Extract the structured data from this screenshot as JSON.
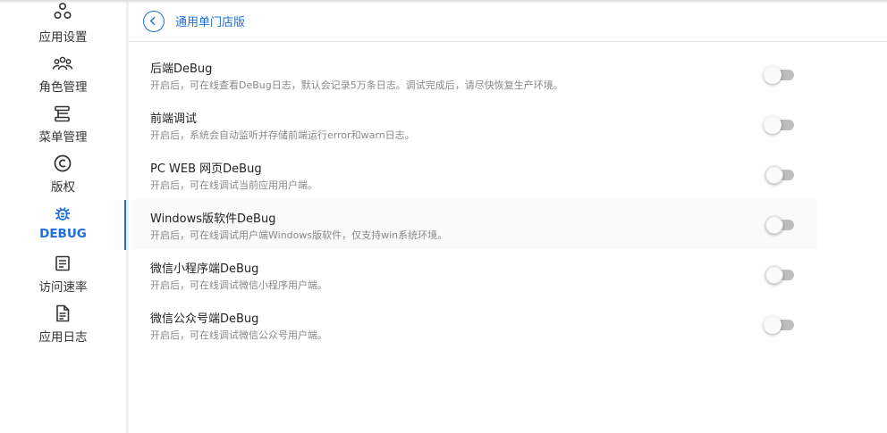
{
  "sidebar": {
    "items": [
      {
        "label": "应用设置",
        "icon": "settings-cluster-icon",
        "active": false
      },
      {
        "label": "角色管理",
        "icon": "users-group-icon",
        "active": false
      },
      {
        "label": "菜单管理",
        "icon": "menu-structure-icon",
        "active": false
      },
      {
        "label": "版权",
        "icon": "copyright-icon",
        "active": false
      },
      {
        "label": "DEBUG",
        "icon": "bug-icon",
        "active": true
      },
      {
        "label": "访问速率",
        "icon": "document-list-icon",
        "active": false
      },
      {
        "label": "应用日志",
        "icon": "file-text-icon",
        "active": false
      }
    ]
  },
  "header": {
    "title": "通用单门店版",
    "back_icon": "chevron-left-icon"
  },
  "colors": {
    "accent": "#1e6fd9",
    "toggle_off": "#bdbdbd",
    "desc_text": "#888888"
  },
  "settings": [
    {
      "title": "后端DeBug",
      "desc": "开启后，可在线查看DeBug日志，默认会记录5万条日志。调试完成后，请尽快恢复生产环境。",
      "enabled": false
    },
    {
      "title": "前端调试",
      "desc": "开启后，系统会自动监听并存储前端运行error和warn日志。",
      "enabled": false
    },
    {
      "title": "PC WEB 网页DeBug",
      "desc": "开启后，可在线调试当前应用用户端。",
      "enabled": false
    },
    {
      "title": "Windows版软件DeBug",
      "desc": "开启后，可在线调试用户端Windows版软件，仅支持win系统环境。",
      "enabled": false
    },
    {
      "title": "微信小程序端DeBug",
      "desc": "开启后，可在线调试微信小程序用户端。",
      "enabled": false
    },
    {
      "title": "微信公众号端DeBug",
      "desc": "开启后，可在线调试微信公众号用户端。",
      "enabled": false
    }
  ]
}
